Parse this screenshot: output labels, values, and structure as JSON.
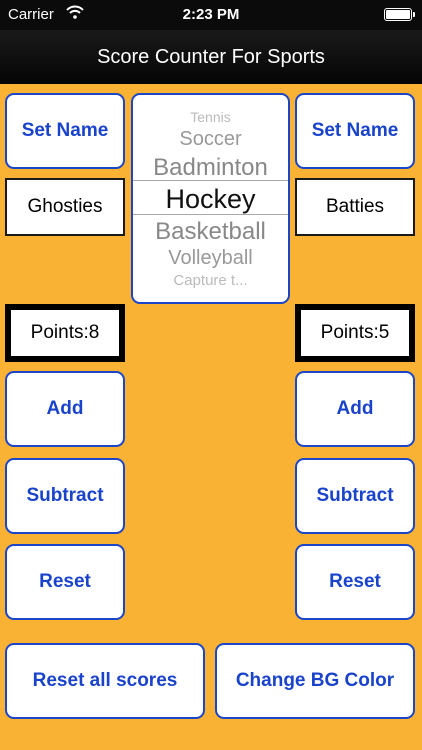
{
  "status_bar": {
    "carrier": "Carrier",
    "time": "2:23 PM"
  },
  "nav": {
    "title": "Score Counter For Sports"
  },
  "picker": {
    "options": [
      "Tennis",
      "Soccer",
      "Badminton",
      "Hockey",
      "Basketball",
      "Volleyball",
      "Capture t..."
    ],
    "selected": "Hockey"
  },
  "left": {
    "set_name_label": "Set Name",
    "team_name": "Ghosties",
    "points": "Points:8",
    "add_label": "Add",
    "subtract_label": "Subtract",
    "reset_label": "Reset"
  },
  "right": {
    "set_name_label": "Set Name",
    "team_name": "Batties",
    "points": "Points:5",
    "add_label": "Add",
    "subtract_label": "Subtract",
    "reset_label": "Reset"
  },
  "footer": {
    "reset_all_label": "Reset all scores",
    "change_bg_label": "Change BG Color"
  },
  "colors": {
    "background": "#f9b233",
    "button_text": "#1a43cc",
    "button_border": "#1c46c8",
    "bar": "#0b0b0b"
  }
}
